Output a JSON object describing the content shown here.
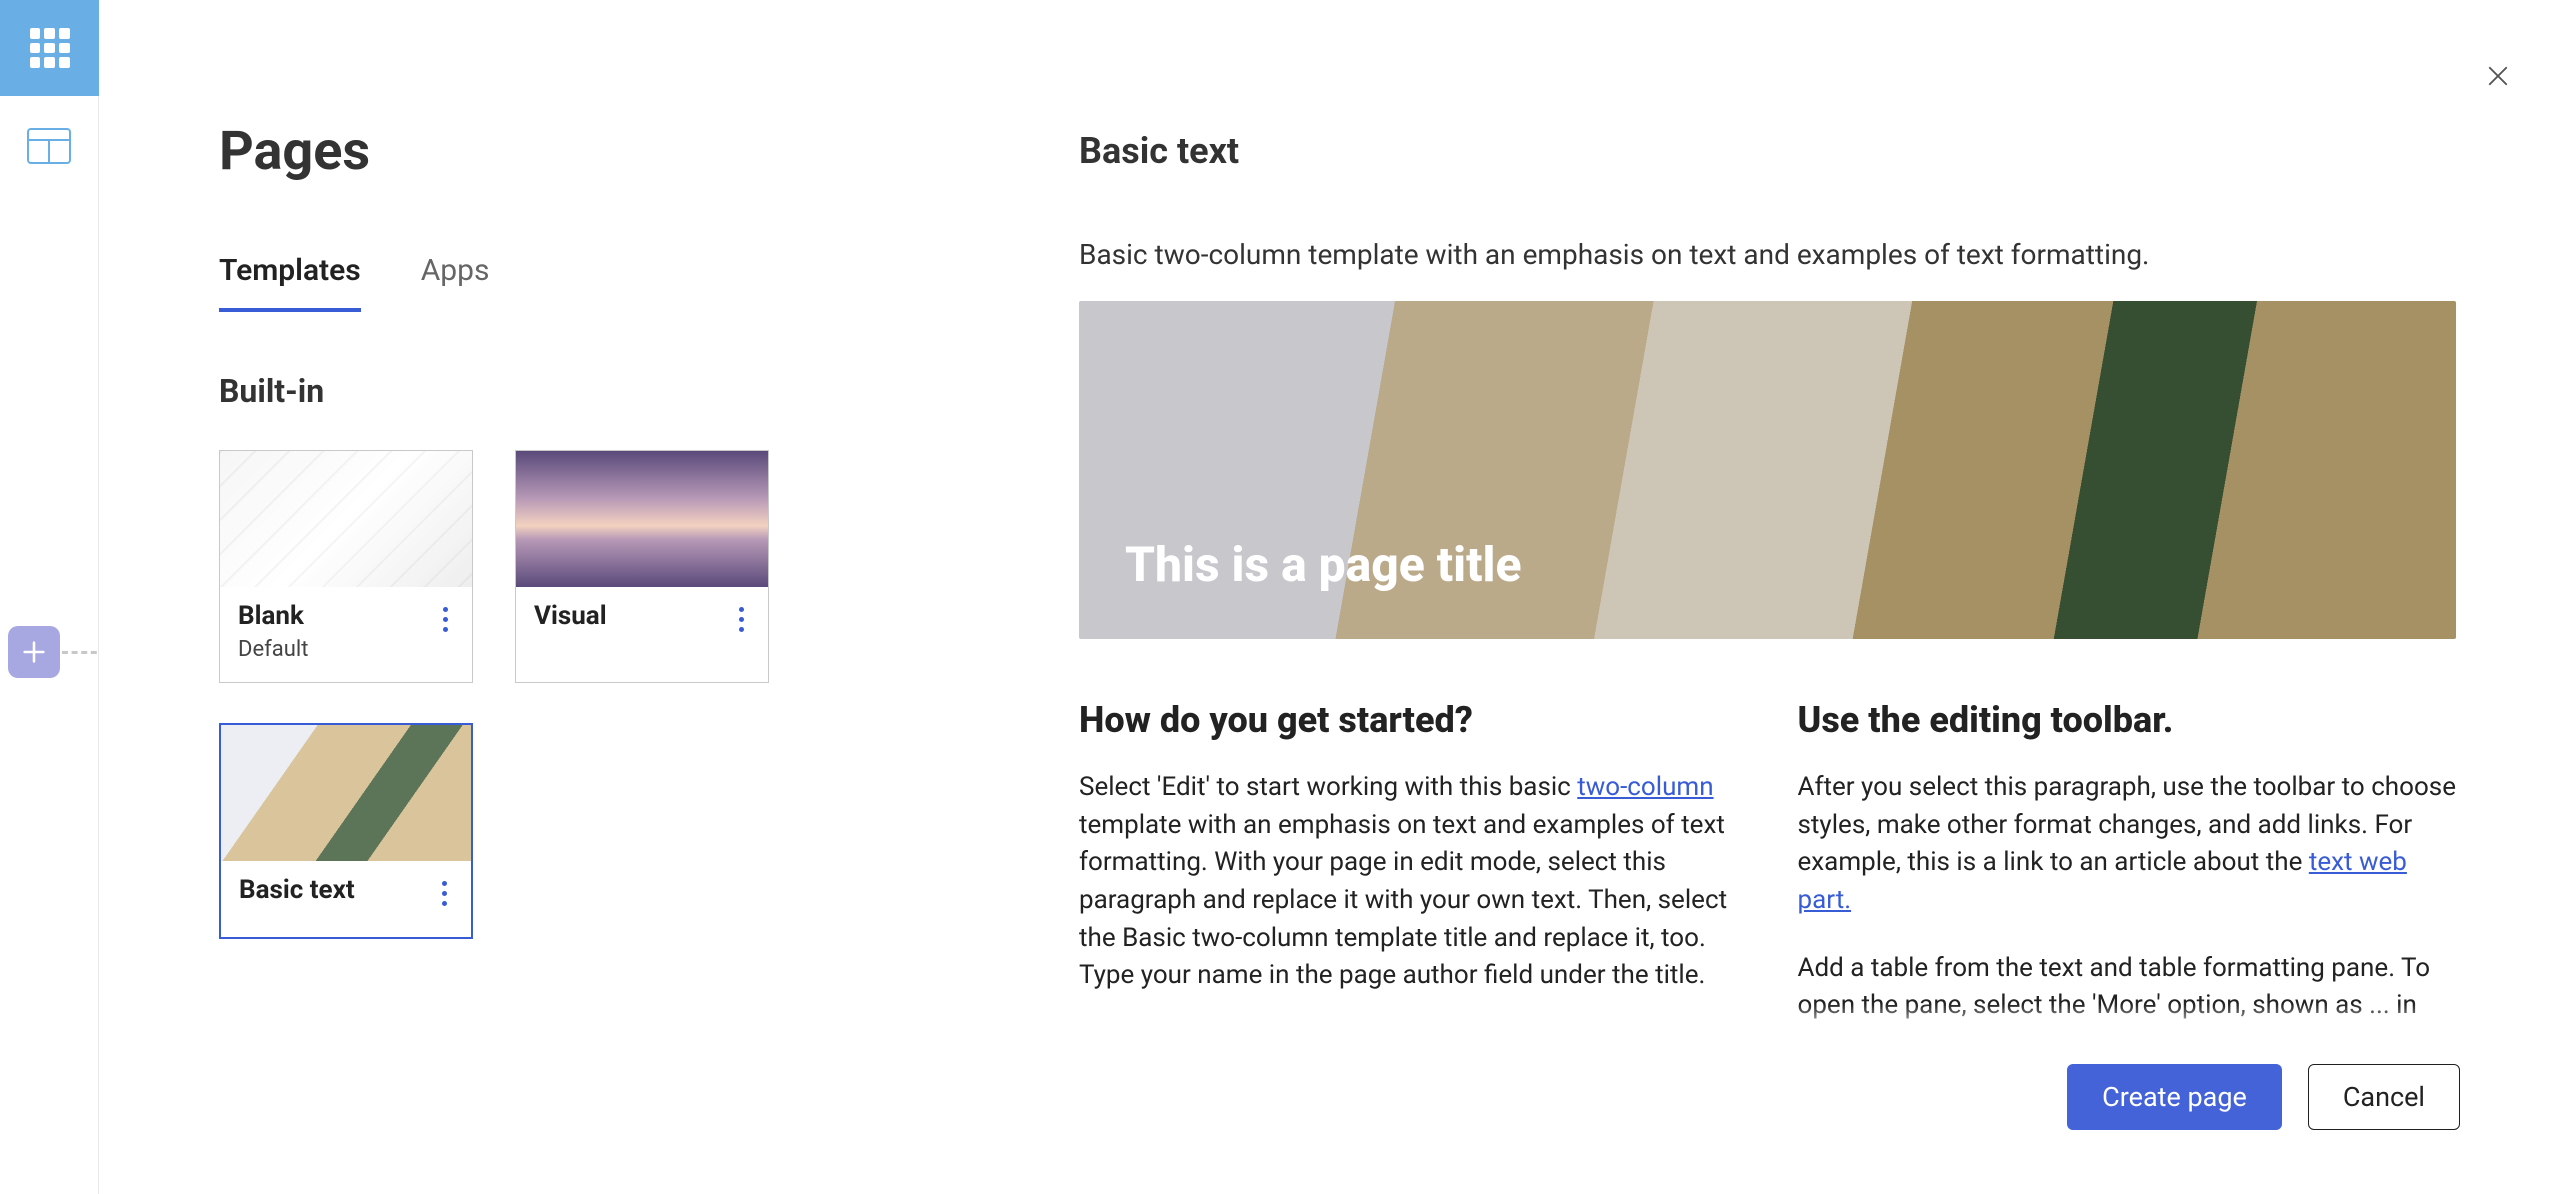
{
  "dialog": {
    "title": "Pages",
    "tabs": [
      "Templates",
      "Apps"
    ],
    "active_tab": 0,
    "section": "Built-in",
    "cards": [
      {
        "title": "Blank",
        "sub": "Default",
        "thumb": "blank",
        "selected": false
      },
      {
        "title": "Visual",
        "sub": "",
        "thumb": "visual",
        "selected": false
      },
      {
        "title": "Basic text",
        "sub": "",
        "thumb": "beach",
        "selected": true
      }
    ]
  },
  "preview": {
    "title": "Basic text",
    "subhead": "Basic two-column template with an emphasis on text and examples of text formatting.",
    "hero_title": "This is a page title",
    "col1": {
      "h": "How do you get started?",
      "p_before_link": "Select 'Edit' to start working with this basic ",
      "link_text": "two-column",
      "p_after_link": " template with an emphasis on text and examples of text formatting. With your page in edit mode, select this paragraph and replace it with your own text. Then, select the Basic two-column template title and replace it, too. Type your name in the page author field under the title."
    },
    "col2": {
      "h": "Use the editing toolbar.",
      "p_before_link": "After you select this paragraph, use the toolbar to choose styles, make other format changes, and add links. For example, this is a link to an article about the ",
      "link_text": "text web part.",
      "p2": "Add a table from the text and table formatting pane. To open the pane, select the 'More' option, shown as ... in"
    }
  },
  "footer": {
    "primary": "Create page",
    "secondary": "Cancel"
  }
}
